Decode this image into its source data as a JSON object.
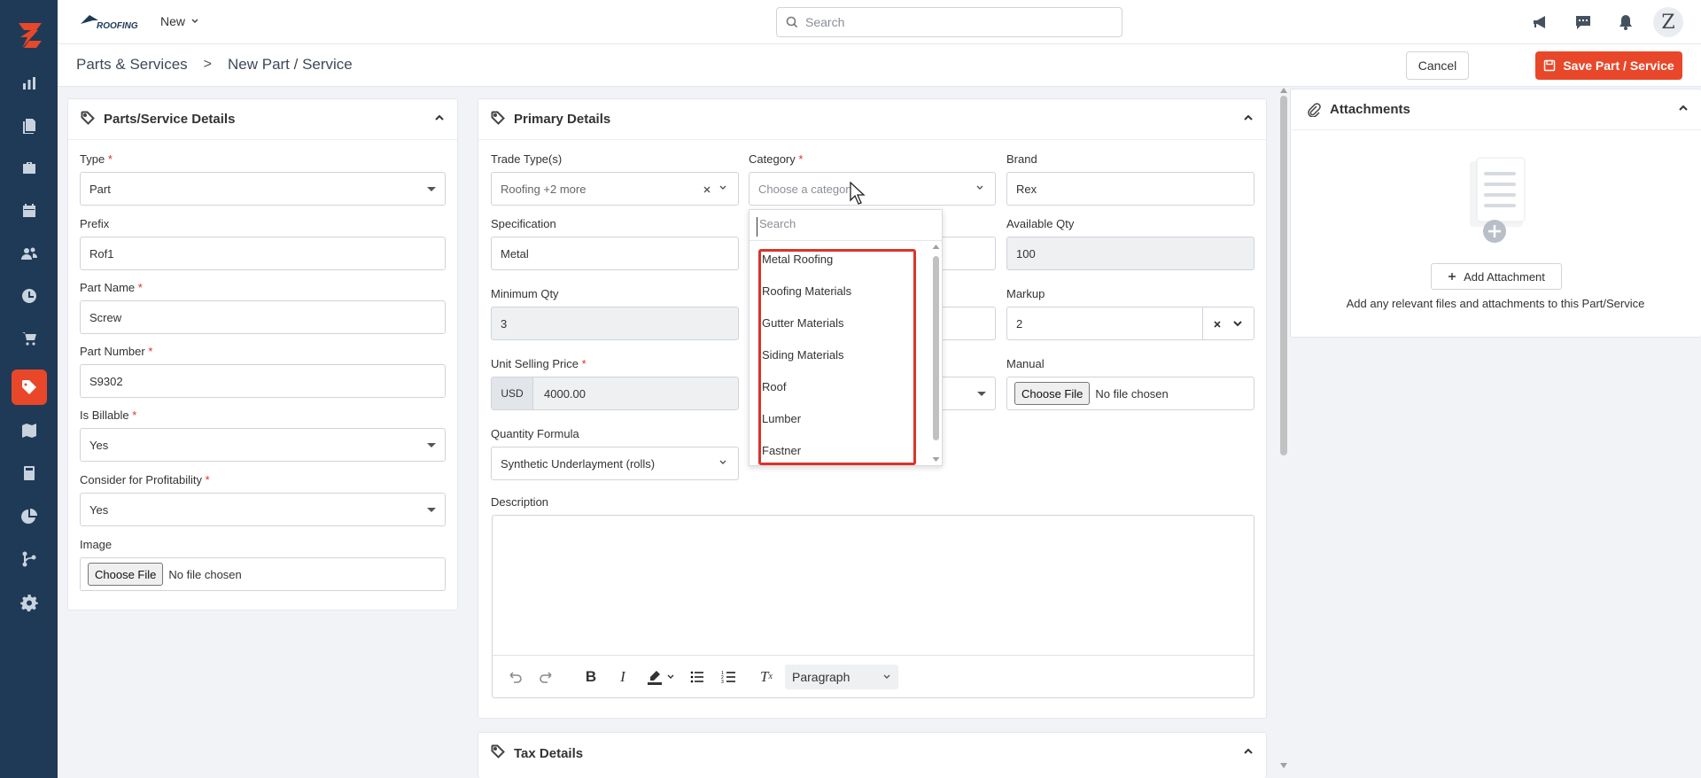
{
  "topbar": {
    "brand": "ROOFING",
    "new_label": "New",
    "search_placeholder": "Search",
    "avatar_initial": "Z"
  },
  "breadcrumb": {
    "parent": "Parts & Services",
    "separator": ">",
    "current": "New Part / Service"
  },
  "actions": {
    "cancel": "Cancel",
    "save": "Save Part / Service"
  },
  "left_card": {
    "title": "Parts/Service Details",
    "type_label": "Type",
    "type_value": "Part",
    "prefix_label": "Prefix",
    "prefix_value": "Rof1",
    "part_name_label": "Part Name",
    "part_name_value": "Screw",
    "part_number_label": "Part Number",
    "part_number_value": "S9302",
    "billable_label": "Is Billable",
    "billable_value": "Yes",
    "profit_label": "Consider for Profitability",
    "profit_value": "Yes",
    "image_label": "Image",
    "choose_file": "Choose File",
    "no_file": "No file chosen",
    "required_mark": "*"
  },
  "primary": {
    "title": "Primary Details",
    "trade_label": "Trade Type(s)",
    "trade_value": "Roofing +2 more",
    "category_label": "Category",
    "category_placeholder": "Choose a category",
    "brand_label": "Brand",
    "brand_value": "Rex",
    "spec_label": "Specification",
    "spec_value": "Metal",
    "avail_label": "Available Qty",
    "avail_value": "100",
    "minqty_label": "Minimum Qty",
    "minqty_value": "3",
    "markup_label": "Markup",
    "markup_value": "2",
    "usp_label": "Unit Selling Price",
    "currency": "USD",
    "usp_value": "4000.00",
    "manual_label": "Manual",
    "choose_file": "Choose File",
    "no_file": "No file chosen",
    "qf_label": "Quantity Formula",
    "qf_value": "Synthetic Underlayment (rolls)",
    "desc_label": "Description",
    "paragraph": "Paragraph",
    "required_mark": "*"
  },
  "category_dropdown": {
    "search_placeholder": "Search",
    "options": [
      "Metal Roofing",
      "Roofing Materials",
      "Gutter Materials",
      "Siding Materials",
      "Roof",
      "Lumber",
      "Fastner"
    ]
  },
  "tax": {
    "title": "Tax Details"
  },
  "attachments": {
    "title": "Attachments",
    "add_label": "Add Attachment",
    "note": "Add any relevant files and attachments to this Part/Service"
  },
  "colors": {
    "sidebar": "#1e3a56",
    "accent": "#e8472a",
    "highlight": "#d9342b"
  }
}
